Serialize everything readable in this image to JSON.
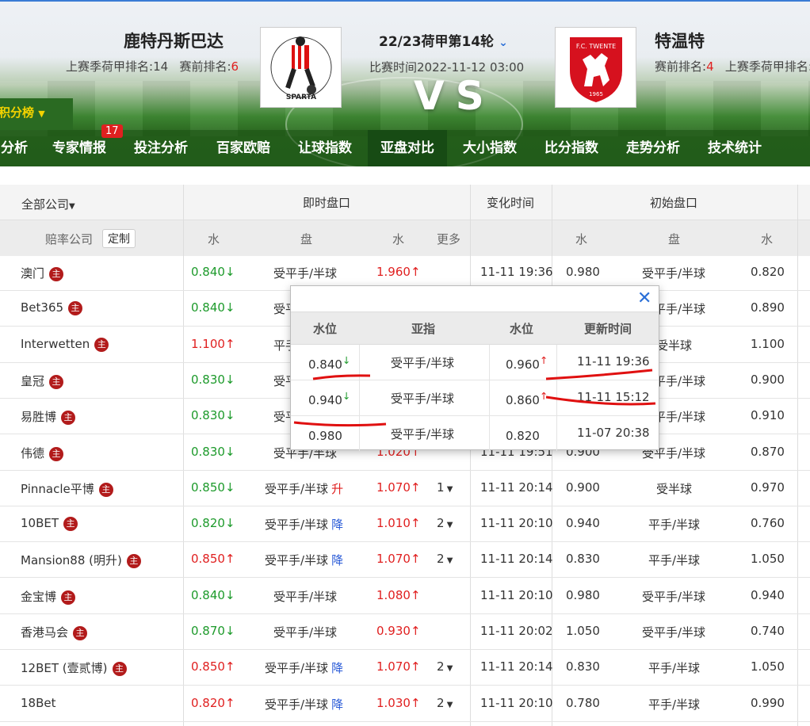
{
  "header": {
    "home": {
      "name": "鹿特丹斯巴达",
      "last_season_label": "上赛季荷甲排名:",
      "last_season_rank": "14",
      "pre_rank_label": "赛前排名:",
      "pre_rank": "6"
    },
    "away": {
      "name": "特温特",
      "pre_rank_label": "赛前排名:",
      "pre_rank": "4",
      "last_season_label": "上赛季荷甲排名:"
    },
    "round": "22/23荷甲第14轮",
    "match_time": "比赛时间2022-11-12 03:00",
    "vs": "VS",
    "standings_tab": "积分榜",
    "away_logo_text": "F.C. TWENTE",
    "away_logo_year": "1965",
    "home_logo_text": "SPARTA"
  },
  "nav": {
    "items": [
      "分析",
      "专家情报",
      "投注分析",
      "百家欧赔",
      "让球指数",
      "亚盘对比",
      "大小指数",
      "比分指数",
      "走势分析",
      "技术统计"
    ],
    "active": "亚盘对比",
    "badge": "17"
  },
  "table": {
    "company_filter": "全部公司",
    "group_live": "即时盘口",
    "group_change": "变化时间",
    "group_init": "初始盘口",
    "company_label": "赔率公司",
    "customize": "定制",
    "col_water": "水",
    "col_line": "盘",
    "col_more": "更多",
    "zhu": "主",
    "rows": [
      {
        "name": "澳门",
        "zhu": true,
        "w1": "0.840",
        "a1": "↓",
        "c1": "g",
        "line": "受平手/半球",
        "tag": "",
        "w2": "1.960",
        "a2": "↑",
        "c2": "r",
        "more": "",
        "time": "11-11 19:36",
        "iw1": "0.980",
        "iline": "受平手/半球",
        "iw2": "0.820"
      },
      {
        "name": "Bet365",
        "zhu": true,
        "w1": "0.840",
        "a1": "↓",
        "c1": "g",
        "line": "受平手/半球",
        "tag": "",
        "w2": "",
        "a2": "",
        "c2": "r",
        "more": "",
        "time": "",
        "iw1": "",
        "iline": "受平手/半球",
        "iw2": "0.890"
      },
      {
        "name": "Interwetten",
        "zhu": true,
        "w1": "1.100",
        "a1": "↑",
        "c1": "r",
        "line": "平手/半球",
        "tag": "",
        "w2": "",
        "a2": "",
        "c2": "r",
        "more": "",
        "time": "",
        "iw1": "",
        "iline": "受半球",
        "iw2": "1.100"
      },
      {
        "name": "皇冠",
        "zhu": true,
        "w1": "0.830",
        "a1": "↓",
        "c1": "g",
        "line": "受平手/半球",
        "tag": "",
        "w2": "",
        "a2": "",
        "c2": "r",
        "more": "",
        "time": "",
        "iw1": "",
        "iline": "受平手/半球",
        "iw2": "0.900"
      },
      {
        "name": "易胜博",
        "zhu": true,
        "w1": "0.830",
        "a1": "↓",
        "c1": "g",
        "line": "受平手/半球",
        "tag": "",
        "w2": "",
        "a2": "",
        "c2": "r",
        "more": "",
        "time": "",
        "iw1": "",
        "iline": "受平手/半球",
        "iw2": "0.910"
      },
      {
        "name": "伟德",
        "zhu": true,
        "w1": "0.830",
        "a1": "↓",
        "c1": "g",
        "line": "受平手/半球",
        "tag": "",
        "w2": "1.020",
        "a2": "↑",
        "c2": "r",
        "more": "",
        "time": "11-11 19:51",
        "iw1": "0.900",
        "iline": "受平手/半球",
        "iw2": "0.870"
      },
      {
        "name": "Pinnacle平博",
        "zhu": true,
        "w1": "0.850",
        "a1": "↓",
        "c1": "g",
        "line": "受平手/半球",
        "tag": "升",
        "tagc": "r",
        "w2": "1.070",
        "a2": "↑",
        "c2": "r",
        "more": "1",
        "time": "11-11 20:14",
        "iw1": "0.900",
        "iline": "受半球",
        "iw2": "0.970"
      },
      {
        "name": "10BET",
        "zhu": true,
        "w1": "0.820",
        "a1": "↓",
        "c1": "g",
        "line": "受平手/半球",
        "tag": "降",
        "tagc": "b",
        "w2": "1.010",
        "a2": "↑",
        "c2": "r",
        "more": "2",
        "time": "11-11 20:10",
        "iw1": "0.940",
        "iline": "平手/半球",
        "iw2": "0.760"
      },
      {
        "name": "Mansion88 (明升)",
        "zhu": true,
        "w1": "0.850",
        "a1": "↑",
        "c1": "r",
        "line": "受平手/半球",
        "tag": "降",
        "tagc": "b",
        "w2": "1.070",
        "a2": "↑",
        "c2": "r",
        "more": "2",
        "time": "11-11 20:14",
        "iw1": "0.830",
        "iline": "平手/半球",
        "iw2": "1.050"
      },
      {
        "name": "金宝博",
        "zhu": true,
        "w1": "0.840",
        "a1": "↓",
        "c1": "g",
        "line": "受平手/半球",
        "tag": "",
        "w2": "1.080",
        "a2": "↑",
        "c2": "r",
        "more": "",
        "time": "11-11 20:10",
        "iw1": "0.980",
        "iline": "受平手/半球",
        "iw2": "0.940"
      },
      {
        "name": "香港马会",
        "zhu": true,
        "w1": "0.870",
        "a1": "↓",
        "c1": "g",
        "line": "受平手/半球",
        "tag": "",
        "w2": "0.930",
        "a2": "↑",
        "c2": "r",
        "more": "",
        "time": "11-11 20:02",
        "iw1": "1.050",
        "iline": "受平手/半球",
        "iw2": "0.740"
      },
      {
        "name": "12BET (壹贰博)",
        "zhu": true,
        "w1": "0.850",
        "a1": "↑",
        "c1": "r",
        "line": "受平手/半球",
        "tag": "降",
        "tagc": "b",
        "w2": "1.070",
        "a2": "↑",
        "c2": "r",
        "more": "2",
        "time": "11-11 20:14",
        "iw1": "0.830",
        "iline": "平手/半球",
        "iw2": "1.050"
      },
      {
        "name": "18Bet",
        "zhu": false,
        "w1": "0.820",
        "a1": "↑",
        "c1": "r",
        "line": "受平手/半球",
        "tag": "降",
        "tagc": "b",
        "w2": "1.030",
        "a2": "↑",
        "c2": "r",
        "more": "2",
        "time": "11-11 20:10",
        "iw1": "0.780",
        "iline": "平手/半球",
        "iw2": "0.990"
      }
    ]
  },
  "popup": {
    "headers": [
      "水位",
      "亚指",
      "水位",
      "更新时间"
    ],
    "rows": [
      {
        "w1": "0.840",
        "a1": "↓",
        "line": "受平手/半球",
        "w2": "0.960",
        "a2": "↑",
        "time": "11-11 19:36"
      },
      {
        "w1": "0.940",
        "a1": "↓",
        "line": "受平手/半球",
        "w2": "0.860",
        "a2": "↑",
        "time": "11-11 15:12"
      },
      {
        "w1": "0.980",
        "a1": "",
        "line": "受平手/半球",
        "w2": "0.820",
        "a2": "",
        "time": "11-07 20:38"
      }
    ]
  },
  "colors": {
    "green": "#1d9a2b",
    "red": "#e02020",
    "blue": "#2a5bd7",
    "nav_active": "#174b14"
  }
}
